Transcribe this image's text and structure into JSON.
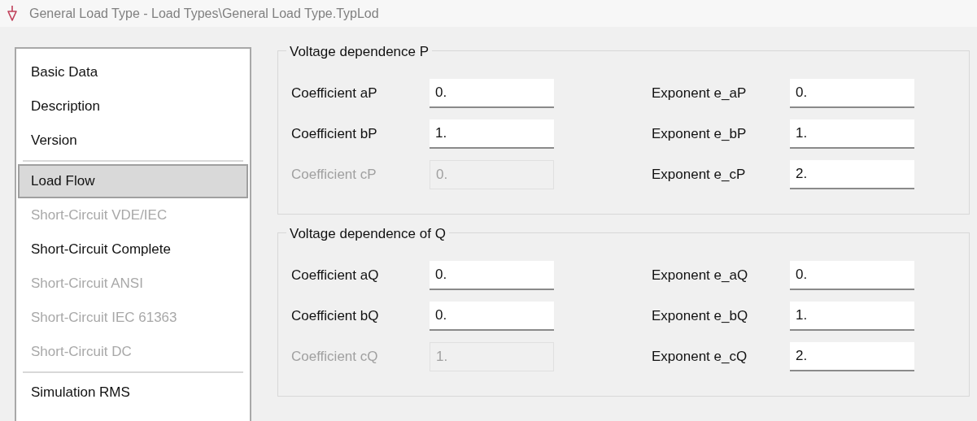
{
  "window": {
    "title": "General Load Type - Load Types\\General Load Type.TypLod"
  },
  "sidebar": {
    "items": [
      {
        "kind": "item",
        "label": "Basic Data",
        "selected": false,
        "disabled": false
      },
      {
        "kind": "item",
        "label": "Description",
        "selected": false,
        "disabled": false
      },
      {
        "kind": "item",
        "label": "Version",
        "selected": false,
        "disabled": false
      },
      {
        "kind": "separator"
      },
      {
        "kind": "item",
        "label": "Load Flow",
        "selected": true,
        "disabled": false
      },
      {
        "kind": "item",
        "label": "Short-Circuit VDE/IEC",
        "selected": false,
        "disabled": true
      },
      {
        "kind": "item",
        "label": "Short-Circuit Complete",
        "selected": false,
        "disabled": false
      },
      {
        "kind": "item",
        "label": "Short-Circuit ANSI",
        "selected": false,
        "disabled": true
      },
      {
        "kind": "item",
        "label": "Short-Circuit IEC 61363",
        "selected": false,
        "disabled": true
      },
      {
        "kind": "item",
        "label": "Short-Circuit DC",
        "selected": false,
        "disabled": true
      },
      {
        "kind": "separator"
      },
      {
        "kind": "item",
        "label": "Simulation RMS",
        "selected": false,
        "disabled": false
      }
    ]
  },
  "groups": [
    {
      "title": "Voltage dependence P",
      "rows": [
        {
          "left": {
            "label": "Coefficient aP",
            "value": "0.",
            "disabled": false
          },
          "right": {
            "label": "Exponent e_aP",
            "value": "0.",
            "disabled": false
          }
        },
        {
          "left": {
            "label": "Coefficient bP",
            "value": "1.",
            "disabled": false
          },
          "right": {
            "label": "Exponent e_bP",
            "value": "1.",
            "disabled": false
          }
        },
        {
          "left": {
            "label": "Coefficient cP",
            "value": "0.",
            "disabled": true
          },
          "right": {
            "label": "Exponent e_cP",
            "value": "2.",
            "disabled": false
          }
        }
      ]
    },
    {
      "title": "Voltage dependence of Q",
      "rows": [
        {
          "left": {
            "label": "Coefficient aQ",
            "value": "0.",
            "disabled": false
          },
          "right": {
            "label": "Exponent e_aQ",
            "value": "0.",
            "disabled": false
          }
        },
        {
          "left": {
            "label": "Coefficient bQ",
            "value": "0.",
            "disabled": false
          },
          "right": {
            "label": "Exponent e_bQ",
            "value": "1.",
            "disabled": false
          }
        },
        {
          "left": {
            "label": "Coefficient cQ",
            "value": "1.",
            "disabled": true
          },
          "right": {
            "label": "Exponent e_cQ",
            "value": "2.",
            "disabled": false
          }
        }
      ]
    }
  ]
}
